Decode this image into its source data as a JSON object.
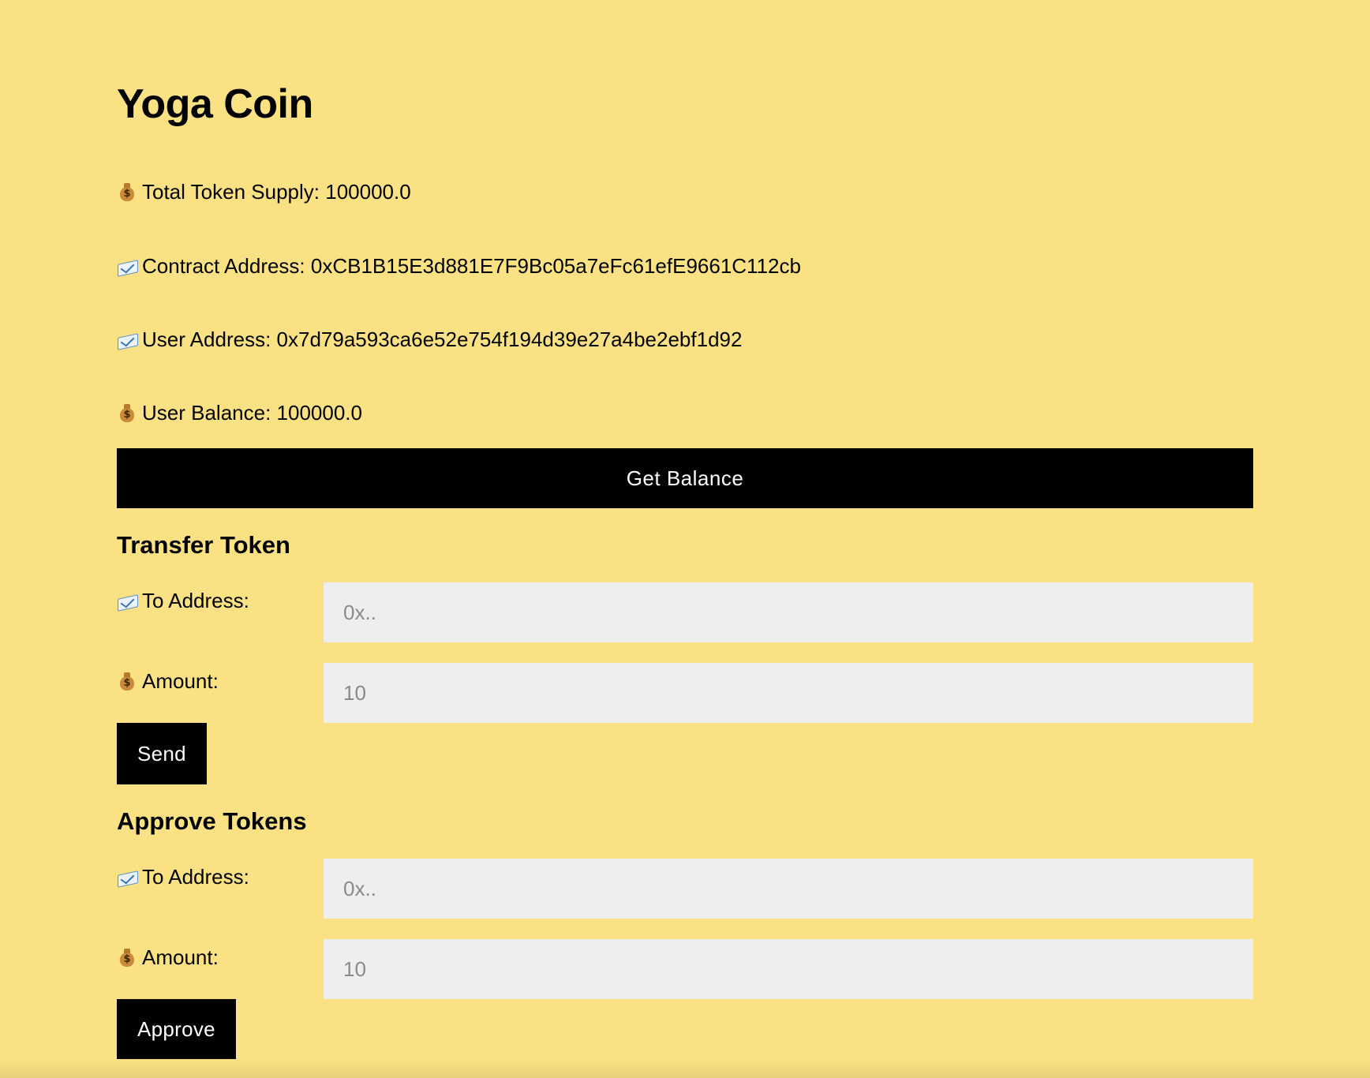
{
  "app": {
    "title": "Yoga Coin",
    "background_color": "#fae183",
    "accent_color": "#000000"
  },
  "info": [
    {
      "icon": "money-bag-icon",
      "label": "Total Token Supply:",
      "value": "100000.0"
    },
    {
      "icon": "envelope-icon",
      "label": "Contract Address:",
      "value": "0xCB1B15E3d881E7F9Bc05a7eFc61efE9661C112cb"
    },
    {
      "icon": "envelope-icon",
      "label": "User Address:",
      "value": "0x7d79a593ca6e52e754f194d39e27a4be2ebf1d92"
    },
    {
      "icon": "money-bag-icon",
      "label": "User Balance:",
      "value": "100000.0"
    }
  ],
  "get_balance_button": {
    "label": "Get Balance"
  },
  "transfer": {
    "heading": "Transfer Token",
    "to_label": "To Address:",
    "to_placeholder": "0x..",
    "to_icon": "envelope-icon",
    "amount_label": "Amount:",
    "amount_placeholder": "10",
    "amount_icon": "money-bag-icon",
    "button_label": "Send"
  },
  "approve": {
    "heading": "Approve Tokens",
    "to_label": "To Address:",
    "to_placeholder": "0x..",
    "to_icon": "envelope-icon",
    "amount_label": "Amount:",
    "amount_placeholder": "10",
    "amount_icon": "money-bag-icon",
    "button_label": "Approve"
  }
}
